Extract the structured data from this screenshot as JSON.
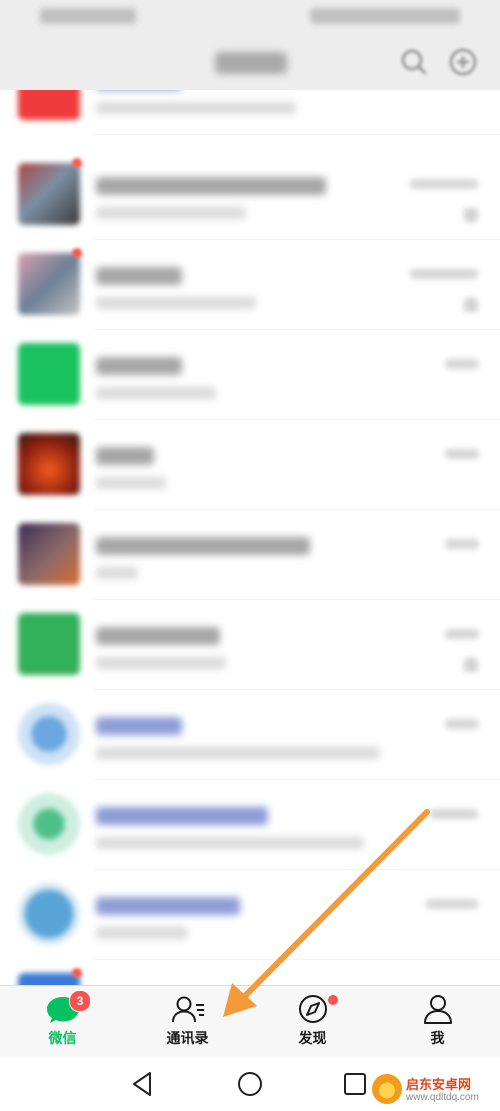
{
  "tabbar": {
    "tabs": [
      {
        "label": "微信",
        "icon": "chat-bubble-icon",
        "badge": "3",
        "active": true
      },
      {
        "label": "通讯录",
        "icon": "contacts-icon",
        "active": false
      },
      {
        "label": "发现",
        "icon": "compass-icon",
        "red_dot": true,
        "active": false
      },
      {
        "label": "我",
        "icon": "person-icon",
        "active": false
      }
    ]
  },
  "colors": {
    "active": "#07c160",
    "badge": "#fa5151",
    "arrow": "#f39a3b",
    "header_bg": "#ededed"
  },
  "watermark": {
    "name": "启东安卓网",
    "url": "www.qdltdq.com"
  }
}
